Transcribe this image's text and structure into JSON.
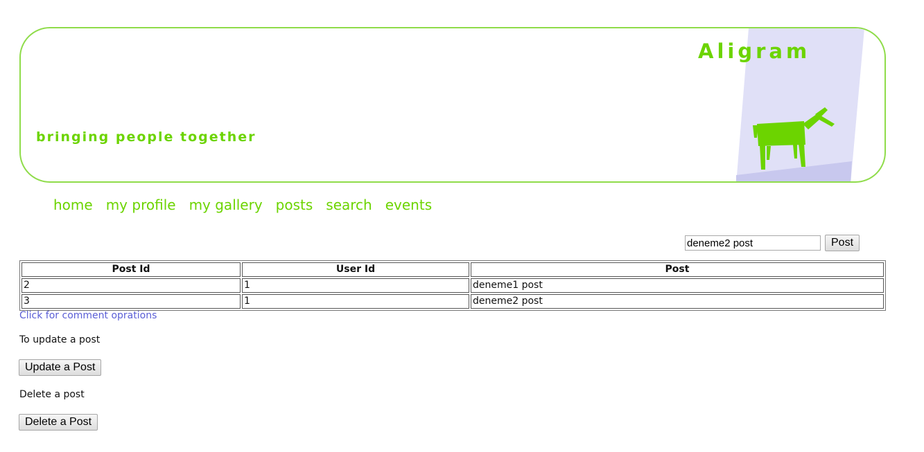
{
  "header": {
    "title": "Aligram",
    "tagline": "bringing people together",
    "logo_icon": "horse-logo-icon",
    "brand_color": "#6cd400",
    "border_color": "#8fdc4a",
    "panel_color": "#e0e0f7"
  },
  "nav": {
    "items": [
      {
        "label": "home"
      },
      {
        "label": "my profile"
      },
      {
        "label": "my gallery"
      },
      {
        "label": "posts"
      },
      {
        "label": "search"
      },
      {
        "label": "events"
      }
    ]
  },
  "post_form": {
    "input_value": "deneme2 post",
    "button_label": "Post"
  },
  "table": {
    "headers": [
      "Post Id",
      "User Id",
      "Post"
    ],
    "rows": [
      [
        "2",
        "1",
        "deneme1 post"
      ],
      [
        "3",
        "1",
        "deneme2 post"
      ]
    ]
  },
  "comment_link": "Click for comment oprations",
  "update": {
    "label": "To update a post",
    "button_label": "Update a Post"
  },
  "delete": {
    "label": "Delete a post",
    "button_label": "Delete a Post"
  },
  "link_color": "#5b5fd6"
}
